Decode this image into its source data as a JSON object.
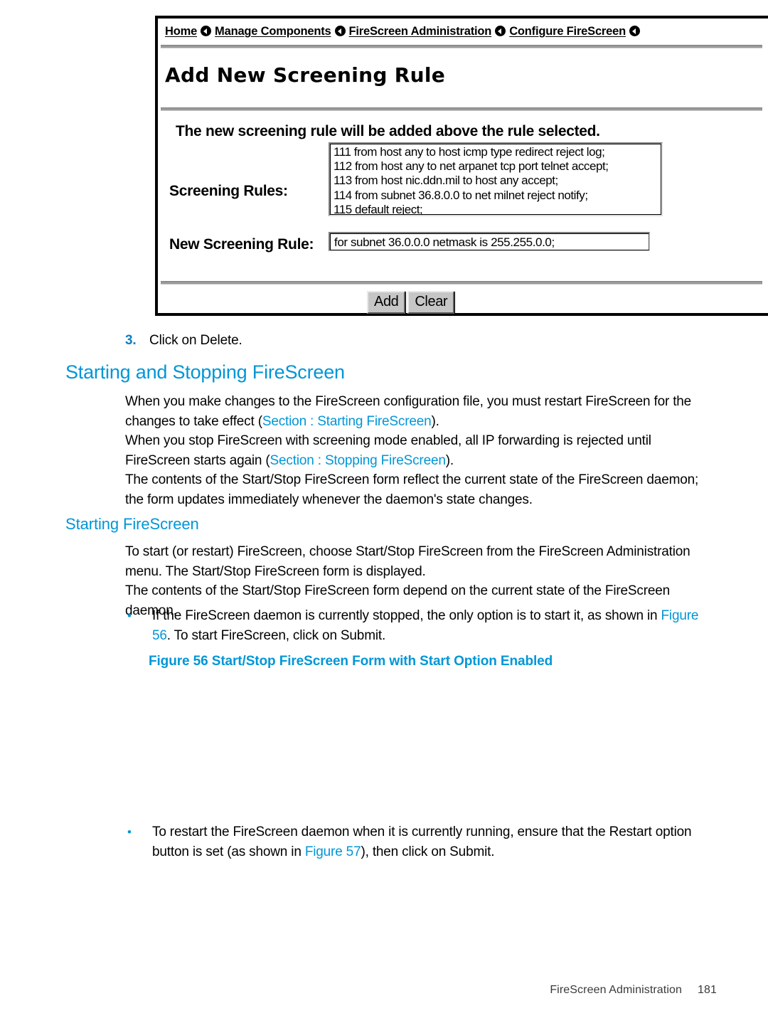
{
  "figure": {
    "breadcrumb": {
      "items": [
        "Home",
        "Manage Components",
        "FireScreen Administration",
        "Configure FireScreen"
      ],
      "separator_icon": "left-triangle-bullet-icon"
    },
    "title": "Add New Screening Rule",
    "notice": "The new screening rule will be added above the rule selected.",
    "screening_rules_label": "Screening Rules:",
    "screening_rules": [
      "111 from host any to host icmp type redirect reject log;",
      "112 from host any to net arpanet tcp port telnet accept;",
      "113 from host nic.ddn.mil to host any accept;",
      "114 from subnet 36.8.0.0 to net milnet reject notify;",
      "115 default reject;"
    ],
    "new_rule_label": "New Screening Rule:",
    "new_rule_value": "for subnet 36.0.0.0 netmask is 255.255.0.0;",
    "buttons": {
      "add": "Add",
      "clear": "Clear"
    }
  },
  "document": {
    "step": {
      "number": "3.",
      "text": "Click on Delete."
    },
    "section_heading": "Starting and Stopping FireScreen",
    "paragraph_1": {
      "before": "When you make changes to the FireScreen configuration file, you must restart FireScreen for the changes to take effect (",
      "xref": "Section : Starting FireScreen",
      "after": ")."
    },
    "paragraph_2": {
      "before": "When you stop FireScreen with screening mode enabled, all IP forwarding is rejected until FireScreen starts again (",
      "xref": "Section : Stopping FireScreen",
      "after": ")."
    },
    "paragraph_3": "The contents of the Start/Stop FireScreen form reflect the current state of the FireScreen daemon; the form updates immediately whenever the daemon's state changes.",
    "subsection_heading": "Starting FireScreen",
    "paragraph_4": "To start (or restart) FireScreen, choose Start/Stop FireScreen from the FireScreen Administration menu. The Start/Stop FireScreen form is displayed.",
    "paragraph_5": "The contents of the Start/Stop FireScreen form depend on the current state of the FireScreen daemon.",
    "bullet_1": {
      "before": "If the FireScreen daemon is currently stopped, the only option is to start it, as shown in ",
      "xref": "Figure 56",
      "after": ". To start FireScreen, click on Submit."
    },
    "figure_caption": "Figure 56 Start/Stop FireScreen Form with Start Option Enabled",
    "bullet_2": {
      "before": "To restart the FireScreen daemon when it is currently running, ensure that the Restart option button is set (as shown in ",
      "xref": "Figure 57",
      "after": "), then click on Submit."
    },
    "footer": {
      "title": "FireScreen Administration",
      "page": "181"
    }
  },
  "colors": {
    "accent_blue": "#0096d6",
    "step_number_blue": "#0e7ec1",
    "button_face": "#c6c6c6",
    "page_background": "#ffffff"
  }
}
